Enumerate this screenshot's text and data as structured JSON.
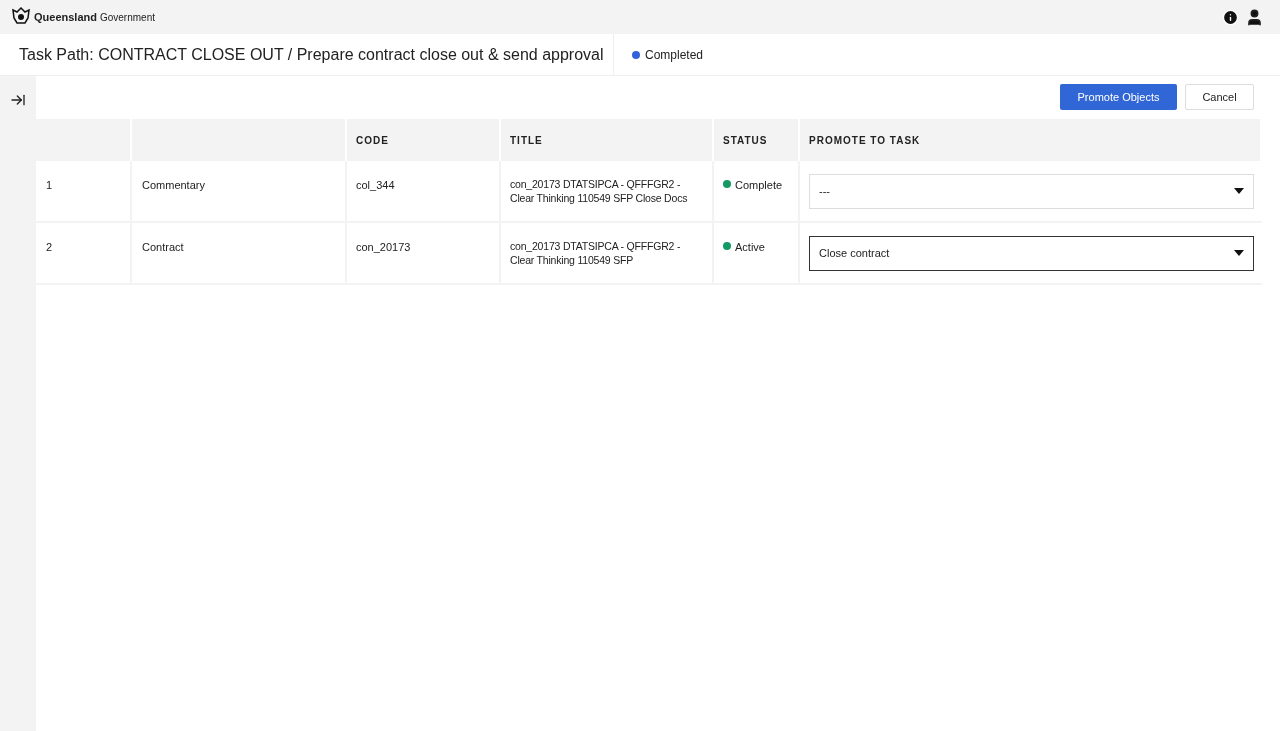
{
  "brand": {
    "name": "Queensland",
    "suffix": "Government"
  },
  "header": {
    "title": "Task Path: CONTRACT CLOSE OUT / Prepare contract close out & send approval",
    "status": {
      "label": "Completed",
      "color": "#3363d8"
    }
  },
  "actions": {
    "primary": "Promote Objects",
    "secondary": "Cancel"
  },
  "table": {
    "columns": [
      "",
      "",
      "CODE",
      "TITLE",
      "STATUS",
      "PROMOTE TO TASK"
    ],
    "rows": [
      {
        "index": "1",
        "type": "Commentary",
        "code": "col_344",
        "title": "con_20173 DTATSIPCA - QFFFGR2 - Clear Thinking 110549 SFP Close Docs",
        "status": "Complete",
        "color": "#139a62",
        "promote": "---",
        "focused": false
      },
      {
        "index": "2",
        "type": "Contract",
        "code": "con_20173",
        "title": "con_20173 DTATSIPCA - QFFFGR2 - Clear Thinking 110549 SFP",
        "status": "Active",
        "color": "#139a62",
        "promote": "Close contract",
        "focused": true
      }
    ]
  }
}
